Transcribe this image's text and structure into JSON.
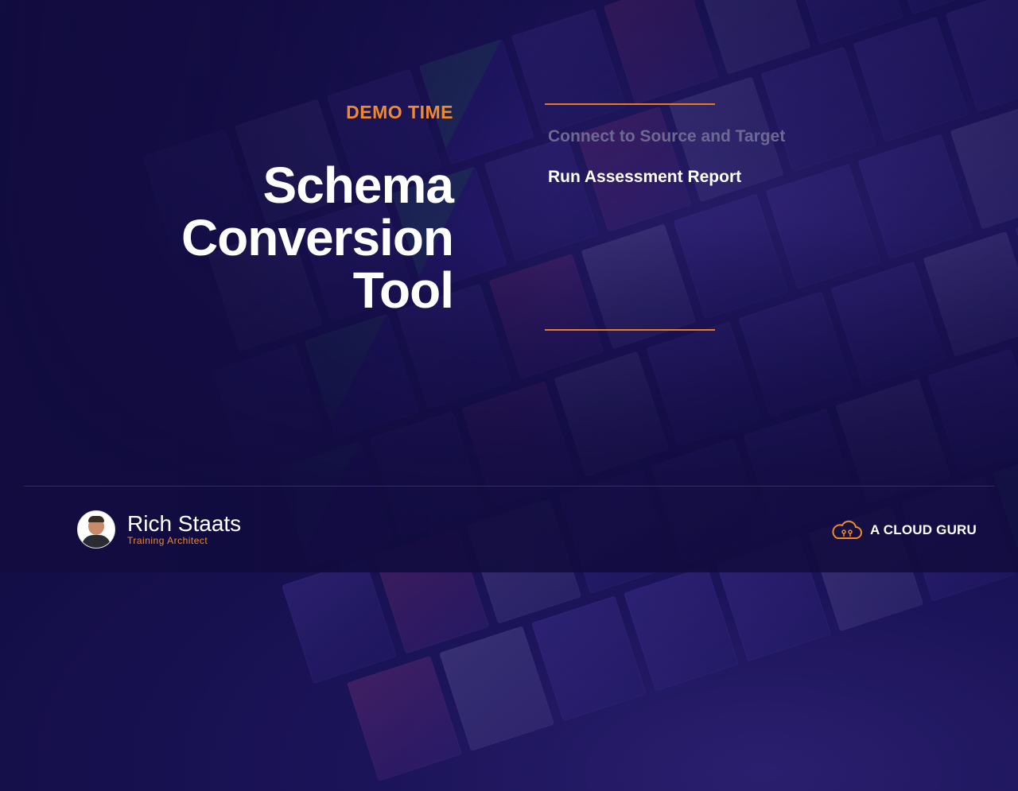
{
  "slide": {
    "eyebrow": "DEMO TIME",
    "title_lines": [
      "Schema",
      "Conversion",
      "Tool"
    ],
    "steps": [
      {
        "label": "Connect to Source and Target",
        "state": "completed"
      },
      {
        "label": "Run Assessment Report",
        "state": "active"
      }
    ]
  },
  "presenter": {
    "name": "Rich Staats",
    "role": "Training Architect",
    "avatar_icon": "presenter-photo"
  },
  "brand": {
    "name": "A CLOUD GURU",
    "logo_icon": "cloud-logo-icon"
  },
  "colors": {
    "accent": "#f08a2c",
    "background": "#150f4a",
    "text": "#ffffff",
    "dim_text": "#6d6a92"
  }
}
